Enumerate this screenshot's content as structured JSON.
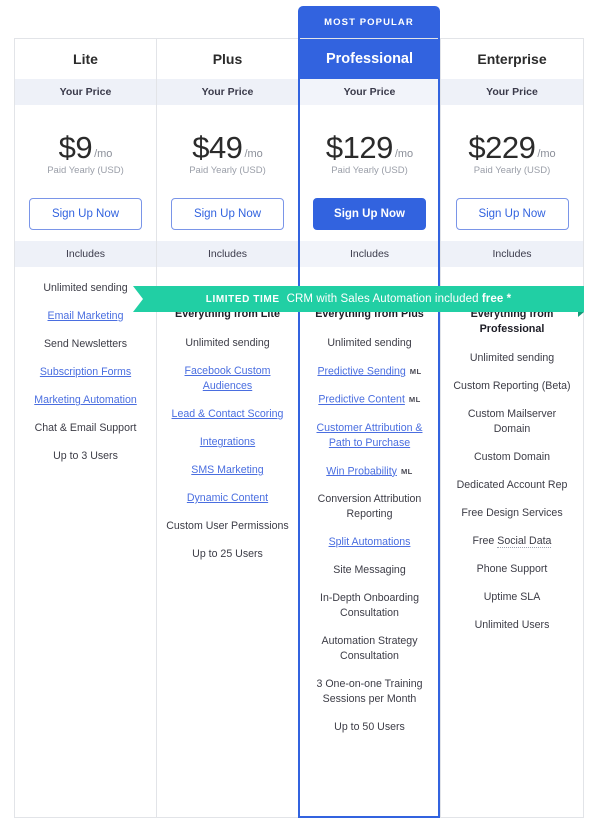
{
  "badge": {
    "most_popular": "MOST POPULAR"
  },
  "labels": {
    "your_price": "Your Price",
    "includes": "Includes",
    "per_month": "/mo",
    "paid_yearly": "Paid Yearly (USD)",
    "signup": "Sign Up Now",
    "ml": "ML"
  },
  "ribbon": {
    "tag": "LIMITED TIME",
    "text_before": "CRM with Sales Automation included ",
    "text_bold": "free *",
    "color": "#21cfa4"
  },
  "accent": {
    "blue": "#3263df",
    "link": "#4a6ee0",
    "band": "#eef1f8"
  },
  "plans": [
    {
      "name": "Lite",
      "featured": false,
      "price": "$9",
      "features": [
        {
          "text": "Unlimited sending",
          "type": "plain"
        },
        {
          "text": "Email Marketing",
          "type": "link"
        },
        {
          "text": "Send Newsletters",
          "type": "plain"
        },
        {
          "text": "Subscription Forms",
          "type": "link"
        },
        {
          "text": "Marketing Automation",
          "type": "link"
        },
        {
          "text": "Chat & Email Support",
          "type": "plain"
        },
        {
          "text": "Up to 3 Users",
          "type": "plain"
        }
      ]
    },
    {
      "name": "Plus",
      "featured": false,
      "price": "$49",
      "features": [
        {
          "text": "Everything from Lite",
          "type": "heading"
        },
        {
          "text": "Unlimited sending",
          "type": "plain"
        },
        {
          "text": "Facebook Custom Audiences",
          "type": "link"
        },
        {
          "text": "Lead & Contact Scoring",
          "type": "link"
        },
        {
          "text": "Integrations",
          "type": "link"
        },
        {
          "text": "SMS Marketing",
          "type": "link"
        },
        {
          "text": "Dynamic Content",
          "type": "link"
        },
        {
          "text": "Custom User Permissions",
          "type": "plain"
        },
        {
          "text": "Up to 25 Users",
          "type": "plain"
        }
      ]
    },
    {
      "name": "Professional",
      "featured": true,
      "price": "$129",
      "features": [
        {
          "text": "Everything from Plus",
          "type": "heading"
        },
        {
          "text": "Unlimited sending",
          "type": "plain"
        },
        {
          "text": "Predictive Sending",
          "type": "link",
          "badge": "ML"
        },
        {
          "text": "Predictive Content",
          "type": "link",
          "badge": "ML"
        },
        {
          "text": "Customer Attribution & Path to Purchase",
          "type": "link"
        },
        {
          "text": "Win Probability",
          "type": "link",
          "badge": "ML"
        },
        {
          "text": "Conversion Attribution Reporting",
          "type": "plain"
        },
        {
          "text": "Split Automations",
          "type": "link"
        },
        {
          "text": "Site Messaging",
          "type": "plain"
        },
        {
          "text": "In-Depth Onboarding Consultation",
          "type": "plain"
        },
        {
          "text": "Automation Strategy Consultation",
          "type": "plain"
        },
        {
          "text": "3 One-on-one Training Sessions per Month",
          "type": "plain"
        },
        {
          "text": "Up to 50 Users",
          "type": "plain"
        }
      ]
    },
    {
      "name": "Enterprise",
      "featured": false,
      "price": "$229",
      "features": [
        {
          "text": "Everything from Professional",
          "type": "heading"
        },
        {
          "text": "Unlimited sending",
          "type": "plain"
        },
        {
          "text": "Custom Reporting (Beta)",
          "type": "plain"
        },
        {
          "text": "Custom Mailserver Domain",
          "type": "plain"
        },
        {
          "text": "Custom Domain",
          "type": "plain"
        },
        {
          "text": "Dedicated Account Rep",
          "type": "plain"
        },
        {
          "text": "Free Design Services",
          "type": "plain"
        },
        {
          "text": "Free Social Data",
          "type": "dotted",
          "dotted_part": "Social Data",
          "plain_part": "Free "
        },
        {
          "text": "Phone Support",
          "type": "plain"
        },
        {
          "text": "Uptime SLA",
          "type": "plain"
        },
        {
          "text": "Unlimited Users",
          "type": "plain"
        }
      ]
    }
  ]
}
